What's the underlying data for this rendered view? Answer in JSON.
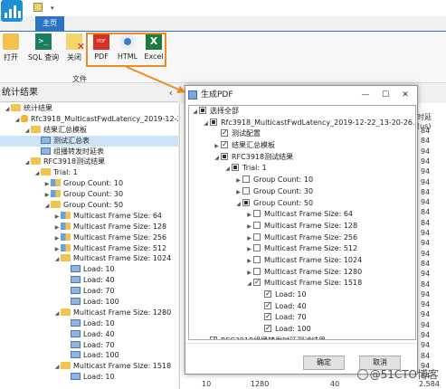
{
  "ribbon": {
    "tab": "主页",
    "buttons": [
      {
        "id": "open",
        "label": "打开"
      },
      {
        "id": "sql",
        "label": "SQL 查询"
      },
      {
        "id": "close",
        "label": "关闭"
      },
      {
        "id": "pdf",
        "label": "PDF"
      },
      {
        "id": "html",
        "label": "HTML"
      },
      {
        "id": "excel",
        "label": "Excel"
      }
    ],
    "pdf_icon_text": "PDF",
    "sql_icon_text": ">_",
    "excel_icon_text": "X",
    "group_label": "文件",
    "highlight_color": "#f08a24"
  },
  "left_panel": {
    "title": "统计结果",
    "tree": [
      {
        "level": 0,
        "arrow": "◢",
        "icon": "folder",
        "label": "统计结果"
      },
      {
        "level": 1,
        "arrow": "◢",
        "icon": "db",
        "label": "Rfc3918_MulticastFwdLatency_2019-12-2..."
      },
      {
        "level": 2,
        "arrow": "◢",
        "icon": "folder",
        "label": "结果汇总模板"
      },
      {
        "level": 3,
        "arrow": "",
        "icon": "grid",
        "label": "测试汇总表",
        "selected": true
      },
      {
        "level": 3,
        "arrow": "",
        "icon": "grid",
        "label": "组播转发时延表"
      },
      {
        "level": 2,
        "arrow": "◢",
        "icon": "folder",
        "label": "RFC3918测试结果"
      },
      {
        "level": 3,
        "arrow": "◢",
        "icon": "folder",
        "label": "Trial: 1"
      },
      {
        "level": 4,
        "arrow": "▶",
        "icon": "group",
        "label": "Group Count: 10"
      },
      {
        "level": 4,
        "arrow": "▶",
        "icon": "group",
        "label": "Group Count: 30"
      },
      {
        "level": 4,
        "arrow": "◢",
        "icon": "folder",
        "label": "Group Count: 50"
      },
      {
        "level": 5,
        "arrow": "▶",
        "icon": "group",
        "label": "Multicast Frame Size: 64"
      },
      {
        "level": 5,
        "arrow": "▶",
        "icon": "group",
        "label": "Multicast Frame Size: 128"
      },
      {
        "level": 5,
        "arrow": "▶",
        "icon": "group",
        "label": "Multicast Frame Size: 256"
      },
      {
        "level": 5,
        "arrow": "▶",
        "icon": "group",
        "label": "Multicast Frame Size: 512"
      },
      {
        "level": 5,
        "arrow": "◢",
        "icon": "folder",
        "label": "Multicast Frame Size: 1024"
      },
      {
        "level": 6,
        "arrow": "",
        "icon": "grid",
        "label": "Load: 10"
      },
      {
        "level": 6,
        "arrow": "",
        "icon": "grid",
        "label": "Load: 40"
      },
      {
        "level": 6,
        "arrow": "",
        "icon": "grid",
        "label": "Load: 70"
      },
      {
        "level": 6,
        "arrow": "",
        "icon": "grid",
        "label": "Load: 100"
      },
      {
        "level": 5,
        "arrow": "◢",
        "icon": "folder",
        "label": "Multicast Frame Size: 1280"
      },
      {
        "level": 6,
        "arrow": "",
        "icon": "grid",
        "label": "Load: 10"
      },
      {
        "level": 6,
        "arrow": "",
        "icon": "grid",
        "label": "Load: 40"
      },
      {
        "level": 6,
        "arrow": "",
        "icon": "grid",
        "label": "Load: 70"
      },
      {
        "level": 6,
        "arrow": "",
        "icon": "grid",
        "label": "Load: 100"
      },
      {
        "level": 5,
        "arrow": "◢",
        "icon": "folder",
        "label": "Multicast Frame Size: 1518"
      },
      {
        "level": 6,
        "arrow": "",
        "icon": "grid",
        "label": "Load: 10"
      }
    ]
  },
  "background_table": {
    "header_partial": "时延 (us)",
    "column_values": [
      "84",
      "84",
      "94",
      "94",
      "94",
      "94",
      "84",
      "94",
      "84",
      "84",
      "94",
      "94",
      "94",
      "84",
      "94",
      "84",
      "94",
      "94",
      "94",
      "94",
      "94",
      "94",
      "84",
      "94",
      "84"
    ],
    "bottom_row": [
      "10",
      "1280",
      "40",
      "2.584"
    ]
  },
  "dialog": {
    "title": "生成PDF",
    "minimize": "—",
    "maximize": "☐",
    "close": "✕",
    "ok": "确定",
    "cancel": "取消",
    "tree": [
      {
        "level": 0,
        "arrow": "◢",
        "check": "partial",
        "label": "选择全部"
      },
      {
        "level": 1,
        "arrow": "◢",
        "check": "partial",
        "label": "Rfc3918_MulticastFwdLatency_2019-12-22_13-20-26.db"
      },
      {
        "level": 2,
        "arrow": "",
        "check": "checked",
        "label": "测试配置"
      },
      {
        "level": 2,
        "arrow": "▶",
        "check": "checked",
        "label": "结果汇总模板"
      },
      {
        "level": 2,
        "arrow": "◢",
        "check": "partial",
        "label": "RFC3918测试结果"
      },
      {
        "level": 3,
        "arrow": "◢",
        "check": "partial",
        "label": "Trial: 1"
      },
      {
        "level": 4,
        "arrow": "▶",
        "check": "unchecked",
        "label": "Group Count: 10"
      },
      {
        "level": 4,
        "arrow": "▶",
        "check": "unchecked",
        "label": "Group Count: 30"
      },
      {
        "level": 4,
        "arrow": "◢",
        "check": "partial",
        "label": "Group Count: 50"
      },
      {
        "level": 5,
        "arrow": "▶",
        "check": "unchecked",
        "label": "Multicast Frame Size: 64"
      },
      {
        "level": 5,
        "arrow": "▶",
        "check": "unchecked",
        "label": "Multicast Frame Size: 128"
      },
      {
        "level": 5,
        "arrow": "▶",
        "check": "unchecked",
        "label": "Multicast Frame Size: 256"
      },
      {
        "level": 5,
        "arrow": "▶",
        "check": "unchecked",
        "label": "Multicast Frame Size: 512"
      },
      {
        "level": 5,
        "arrow": "▶",
        "check": "unchecked",
        "label": "Multicast Frame Size: 1024"
      },
      {
        "level": 5,
        "arrow": "▶",
        "check": "unchecked",
        "label": "Multicast Frame Size: 1280"
      },
      {
        "level": 5,
        "arrow": "◢",
        "check": "checked",
        "label": "Multicast Frame Size: 1518"
      },
      {
        "level": 6,
        "arrow": "",
        "check": "checked",
        "label": "Load: 10"
      },
      {
        "level": 6,
        "arrow": "",
        "check": "checked",
        "label": "Load: 40"
      },
      {
        "level": 6,
        "arrow": "",
        "check": "checked",
        "label": "Load: 70"
      },
      {
        "level": 6,
        "arrow": "",
        "check": "checked",
        "label": "Load: 100"
      },
      {
        "level": 1,
        "arrow": "",
        "check": "checked",
        "label": "RFC3918组播转发时延测试结果"
      }
    ]
  },
  "watermark": "@51CTO博客"
}
